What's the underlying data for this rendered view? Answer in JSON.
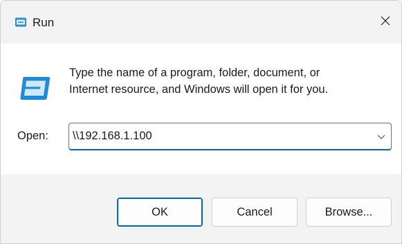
{
  "window": {
    "title": "Run",
    "close_symbol": "✕"
  },
  "icons": {
    "title": "run-icon",
    "body": "run-icon",
    "close": "close-icon",
    "dropdown": "chevron-down-icon"
  },
  "body": {
    "description_line1": "Type the name of a program, folder, document, or",
    "description_line2": "Internet resource, and Windows will open it for you.",
    "open_label": "Open:",
    "open_value": "\\\\192.168.1.100"
  },
  "buttons": {
    "ok": "OK",
    "cancel": "Cancel",
    "browse": "Browse..."
  },
  "colors": {
    "accent": "#0067c0",
    "titlebar_bg": "#f3f3f3",
    "footer_bg": "#f3f3f3",
    "body_bg": "#ffffff"
  }
}
